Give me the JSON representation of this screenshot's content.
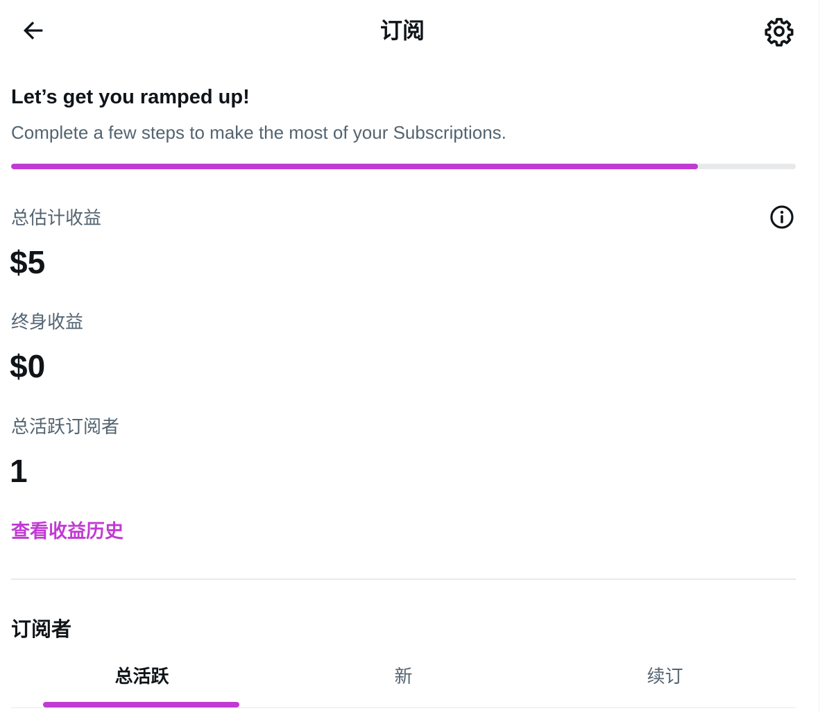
{
  "header": {
    "title": "订阅",
    "back_icon": "arrow-left-icon",
    "settings_icon": "gear-icon"
  },
  "onboarding": {
    "heading": "Let’s get you ramped up!",
    "subtitle": "Complete a few steps to make the most of your Subscriptions.",
    "progress_fraction": 0.875,
    "progress_color": "#c13ad3"
  },
  "stats": {
    "estimated_earnings_label": "总估计收益",
    "estimated_earnings_value": "$5",
    "info_icon": "info-circle-icon",
    "lifetime_earnings_label": "终身收益",
    "lifetime_earnings_value": "$0",
    "active_subscribers_label": "总活跃订阅者",
    "active_subscribers_value": "1"
  },
  "history_link": "查看收益历史",
  "subscribers": {
    "title": "订阅者",
    "tabs": [
      {
        "label": "总活跃",
        "active": true
      },
      {
        "label": "新",
        "active": false
      },
      {
        "label": "续订",
        "active": false
      }
    ]
  },
  "colors": {
    "accent": "#c13ad3",
    "text_primary": "#0f1419",
    "text_secondary": "#536471",
    "divider": "#e7e9ea"
  }
}
